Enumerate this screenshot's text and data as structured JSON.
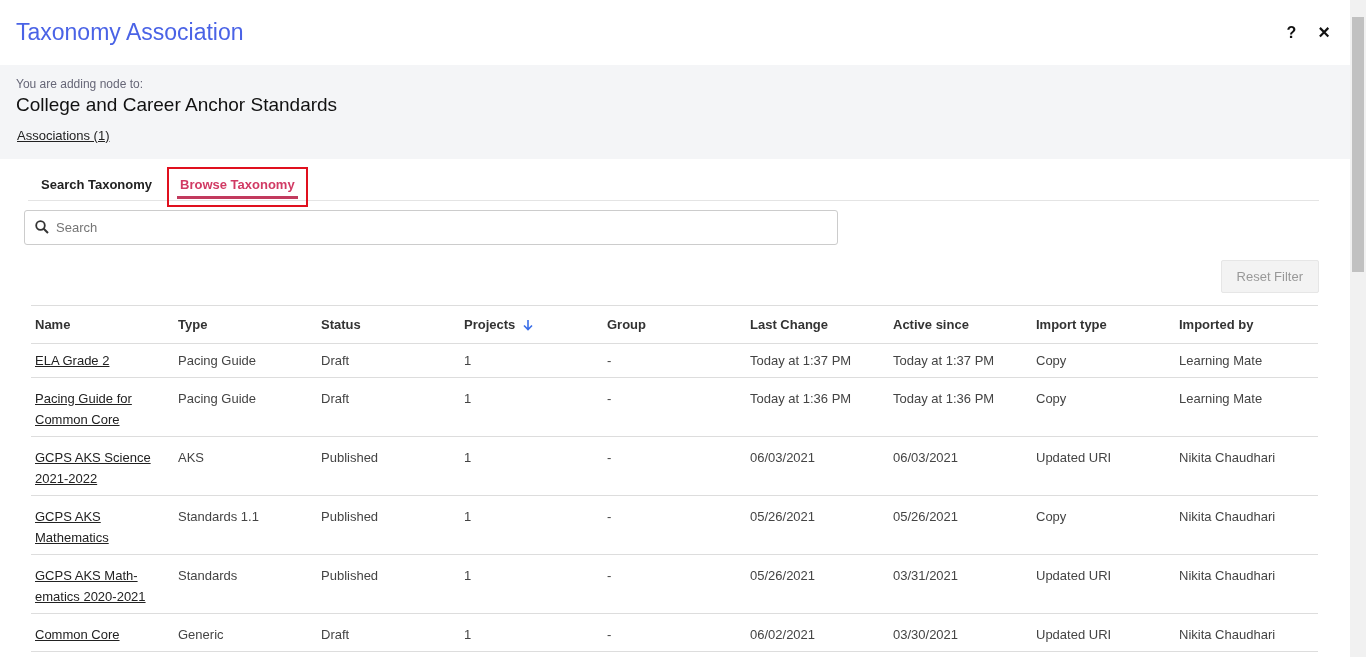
{
  "window": {
    "title": "Taxonomy Association"
  },
  "header_actions": [
    {
      "kind": "help",
      "label": "?"
    },
    {
      "kind": "close",
      "label": "×"
    }
  ],
  "context": {
    "caption": "You are adding node to:",
    "node": "College and Career Anchor Standards",
    "associations_link": "Associations (1)"
  },
  "tabs": [
    {
      "label": "Search Taxonomy",
      "selected": false,
      "highlighted": false
    },
    {
      "label": "Browse Taxonomy",
      "selected": true,
      "highlighted": true
    }
  ],
  "search": {
    "placeholder": "Search"
  },
  "reset_button": {
    "label": "Reset Filter",
    "disabled": true
  },
  "table": {
    "columns": [
      {
        "label": "Name",
        "sorted": false
      },
      {
        "label": "Type",
        "sorted": false
      },
      {
        "label": "Status",
        "sorted": false
      },
      {
        "label": "Projects",
        "sorted": true
      },
      {
        "label": "Group",
        "sorted": false
      },
      {
        "label": "Last Change",
        "sorted": false
      },
      {
        "label": "Active since",
        "sorted": false
      },
      {
        "label": "Import type",
        "sorted": false
      },
      {
        "label": "Imported by",
        "sorted": false
      }
    ],
    "rows": [
      [
        "ELA Grade 2",
        "Pacing Guide",
        "Draft",
        "1",
        "-",
        "Today at 1:37 PM",
        "Today at 1:37 PM",
        "Copy",
        "Learning Mate"
      ],
      [
        "Pacing Guide for Common Core",
        "Pacing Guide",
        "Draft",
        "1",
        "-",
        "Today at 1:36 PM",
        "Today at 1:36 PM",
        "Copy",
        "Learning Mate"
      ],
      [
        "GCPS AKS Science 2021-2022",
        "AKS",
        "Published",
        "1",
        "-",
        "06/03/2021",
        "06/03/2021",
        "Updated URI",
        "Nikita Chaudhari"
      ],
      [
        "GCPS AKS Mathematics",
        "Standards 1.1",
        "Published",
        "1",
        "-",
        "05/26/2021",
        "05/26/2021",
        "Copy",
        "Nikita Chaudhari"
      ],
      [
        "GCPS AKS Math-ematics 2020-2021",
        "Standards",
        "Published",
        "1",
        "-",
        "05/26/2021",
        "03/31/2021",
        "Updated URI",
        "Nikita Chaudhari"
      ],
      [
        "Common Core",
        "Generic",
        "Draft",
        "1",
        "-",
        "06/02/2021",
        "03/30/2021",
        "Updated URI",
        "Nikita Chaudhari"
      ]
    ]
  }
}
